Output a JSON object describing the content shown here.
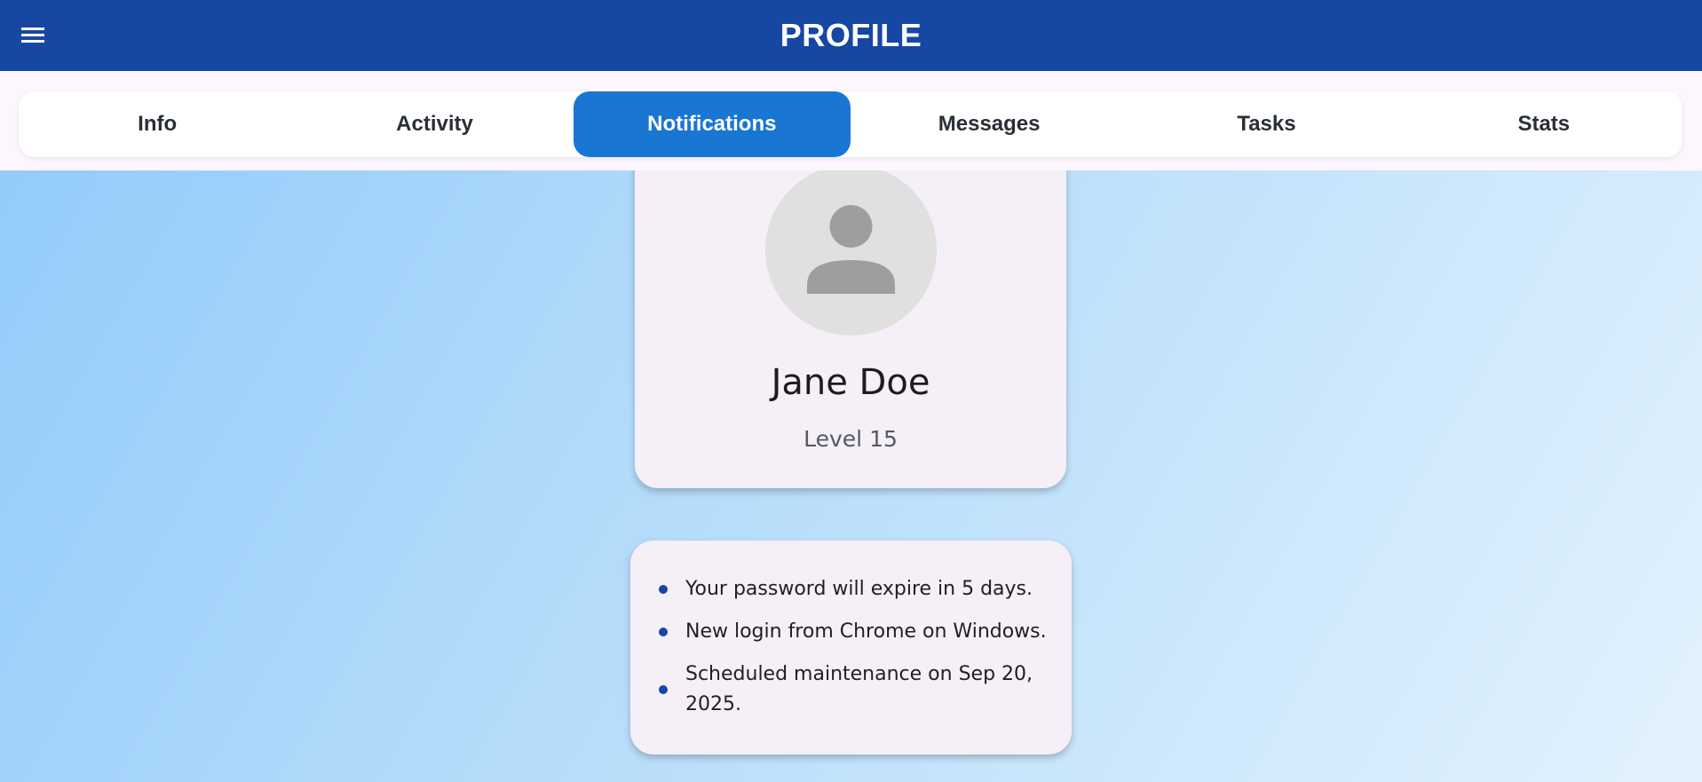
{
  "appbar": {
    "title": "PROFILE",
    "menu_icon": "hamburger-menu-icon",
    "background": "#1647a3"
  },
  "tabs": [
    {
      "label": "Info",
      "active": false
    },
    {
      "label": "Activity",
      "active": false
    },
    {
      "label": "Notifications",
      "active": true
    },
    {
      "label": "Messages",
      "active": false
    },
    {
      "label": "Tasks",
      "active": false
    },
    {
      "label": "Stats",
      "active": false
    }
  ],
  "profile": {
    "avatar_icon": "person-icon",
    "name": "Jane Doe",
    "level": "Level 15"
  },
  "notifications": [
    "Your password will expire in 5 days.",
    "New login from Chrome on Windows.",
    "Scheduled maintenance on Sep 20, 2025."
  ],
  "colors": {
    "accent": "#1976d2",
    "primary": "#1647a3",
    "card": "#f5eff7"
  }
}
